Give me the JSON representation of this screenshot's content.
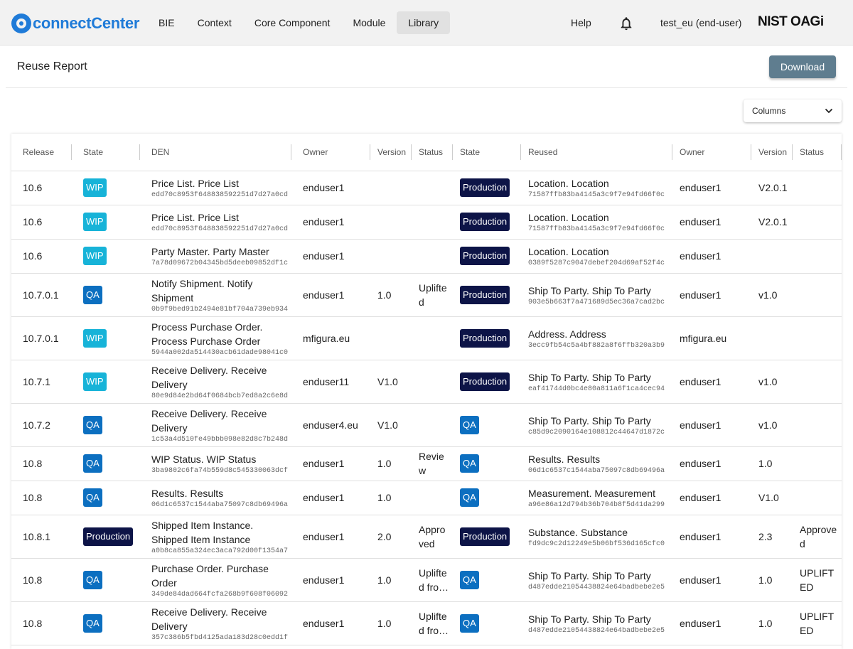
{
  "app": {
    "brand": "connectCenter",
    "partner_logo": "NIST OAGi"
  },
  "nav": {
    "items": [
      "BIE",
      "Context",
      "Core Component",
      "Module",
      "Library"
    ],
    "active": "Library"
  },
  "header": {
    "help": "Help",
    "user": "test_eu (end-user)"
  },
  "page": {
    "title": "Reuse Report",
    "download_label": "Download",
    "columns_label": "Columns"
  },
  "colors": {
    "wip": "#17b3d8",
    "qa": "#0c6fc0",
    "production": "#0d1447",
    "download": "#5f7d8f"
  },
  "table": {
    "headers": [
      "Release",
      "State",
      "DEN",
      "Owner",
      "Version",
      "Status",
      "State",
      "Reused",
      "Owner",
      "Version",
      "Status"
    ],
    "rows": [
      {
        "release": "10.6",
        "state": "WIP",
        "den": "Price List. Price List",
        "den_id": "edd70c8953f648838592251d7d27a0cd",
        "owner": "enduser1",
        "version": "",
        "status": "",
        "r_state": "Production",
        "reused": "Location. Location",
        "reused_id": "71587ffb83ba4145a3c9f7e94fd66f0c",
        "r_owner": "enduser1",
        "r_version": "V2.0.1",
        "r_status": ""
      },
      {
        "release": "10.6",
        "state": "WIP",
        "den": "Price List. Price List",
        "den_id": "edd70c8953f648838592251d7d27a0cd",
        "owner": "enduser1",
        "version": "",
        "status": "",
        "r_state": "Production",
        "reused": "Location. Location",
        "reused_id": "71587ffb83ba4145a3c9f7e94fd66f0c",
        "r_owner": "enduser1",
        "r_version": "V2.0.1",
        "r_status": ""
      },
      {
        "release": "10.6",
        "state": "WIP",
        "den": "Party Master. Party Master",
        "den_id": "7a78d09672b04345bd5deeb09852df1c",
        "owner": "enduser1",
        "version": "",
        "status": "",
        "r_state": "Production",
        "reused": "Location. Location",
        "reused_id": "0389f5287c9047debef204d69af52f4c",
        "r_owner": "enduser1",
        "r_version": "",
        "r_status": ""
      },
      {
        "release": "10.7.0.1",
        "state": "QA",
        "den": "Notify Shipment. Notify Shipment",
        "den_id": "0b9f9bed91b2494e81bf704a739eb934",
        "owner": "enduser1",
        "version": "1.0",
        "status": "Uplifted",
        "r_state": "Production",
        "reused": "Ship To Party. Ship To Party",
        "reused_id": "903e5b663f7a471689d5ec36a7cad2bc",
        "r_owner": "enduser1",
        "r_version": "v1.0",
        "r_status": ""
      },
      {
        "release": "10.7.0.1",
        "state": "WIP",
        "den": "Process Purchase Order. Process Purchase Order",
        "den_id": "5944a002da514430acb61dade98041c0",
        "owner": "mfigura.eu",
        "version": "",
        "status": "",
        "r_state": "Production",
        "reused": "Address. Address",
        "reused_id": "3ecc9fb54c5a4bf882a8f6ffb320a3b9",
        "r_owner": "mfigura.eu",
        "r_version": "",
        "r_status": ""
      },
      {
        "release": "10.7.1",
        "state": "WIP",
        "den": "Receive Delivery. Receive Delivery",
        "den_id": "80e9d84e2bd64f0684bcb7ed8a2c6e8d",
        "owner": "enduser11",
        "version": "V1.0",
        "status": "",
        "r_state": "Production",
        "reused": "Ship To Party. Ship To Party",
        "reused_id": "eaf41744d0bc4e80a811a6f1ca4cec94",
        "r_owner": "enduser1",
        "r_version": "v1.0",
        "r_status": ""
      },
      {
        "release": "10.7.2",
        "state": "QA",
        "den": "Receive Delivery. Receive Delivery",
        "den_id": "1c53a4d510fe49bbb098e82d8c7b248d",
        "owner": "enduser4.eu",
        "version": "V1.0",
        "status": "",
        "r_state": "QA",
        "reused": "Ship To Party. Ship To Party",
        "reused_id": "c85d9c2090164e108812c44647d1872c",
        "r_owner": "enduser1",
        "r_version": "v1.0",
        "r_status": ""
      },
      {
        "release": "10.8",
        "state": "QA",
        "den": "WIP Status. WIP Status",
        "den_id": "3ba9802c6fa74b559d8c545330063dcf",
        "owner": "enduser1",
        "version": "1.0",
        "status": "Review",
        "r_state": "QA",
        "reused": "Results. Results",
        "reused_id": "06d1c6537c1544aba75097c8db69496a",
        "r_owner": "enduser1",
        "r_version": "1.0",
        "r_status": ""
      },
      {
        "release": "10.8",
        "state": "QA",
        "den": "Results. Results",
        "den_id": "06d1c6537c1544aba75097c8db69496a",
        "owner": "enduser1",
        "version": "1.0",
        "status": "",
        "r_state": "QA",
        "reused": "Measurement. Measurement",
        "reused_id": "a96e86a12d794b36b704b8f5d41da299",
        "r_owner": "enduser1",
        "r_version": "V1.0",
        "r_status": ""
      },
      {
        "release": "10.8.1",
        "state": "Production",
        "den": "Shipped Item Instance. Shipped Item Instance",
        "den_id": "a0b8ca855a324ec3aca792d00f1354a7",
        "owner": "enduser1",
        "version": "2.0",
        "status": "Approved",
        "r_state": "Production",
        "reused": "Substance. Substance",
        "reused_id": "fd9dc9c2d12249e5b06bf536d165cfc0",
        "r_owner": "enduser1",
        "r_version": "2.3",
        "r_status": "Approved"
      },
      {
        "release": "10.8",
        "state": "QA",
        "den": "Purchase Order. Purchase Order",
        "den_id": "349de84dad664fcfa268b9f608f06092",
        "owner": "enduser1",
        "version": "1.0",
        "status": "Uplifted fro…",
        "r_state": "QA",
        "reused": "Ship To Party. Ship To Party",
        "reused_id": "d487edde21054438824e64badbebe2e5",
        "r_owner": "enduser1",
        "r_version": "1.0",
        "r_status": "UPLIFTED"
      },
      {
        "release": "10.8",
        "state": "QA",
        "den": "Receive Delivery. Receive Delivery",
        "den_id": "357c386b5fbd4125ada183d28c0edd1f",
        "owner": "enduser1",
        "version": "1.0",
        "status": "Uplifted fro…",
        "r_state": "QA",
        "reused": "Ship To Party. Ship To Party",
        "reused_id": "d487edde21054438824e64badbebe2e5",
        "r_owner": "enduser1",
        "r_version": "1.0",
        "r_status": "UPLIFTED"
      }
    ]
  }
}
